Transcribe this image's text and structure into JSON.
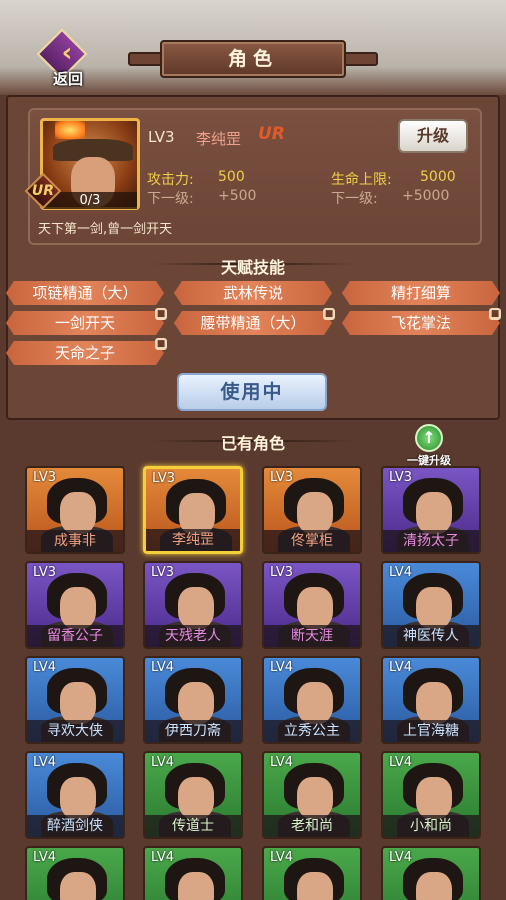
{
  "header": {
    "title": "角色",
    "back_label": "返回"
  },
  "hero": {
    "level": "LV3",
    "name": "李纯罡",
    "grade": "UR",
    "stars": "0/3",
    "upgrade_label": "升级",
    "attack_label": "攻击力:",
    "attack_value": "500",
    "next_label": "下一级:",
    "attack_next": "+500",
    "hp_label": "生命上限:",
    "hp_value": "5000",
    "hp_next": "+5000",
    "description": "天下第一剑,曾一剑开天"
  },
  "talents": {
    "title": "天赋技能",
    "skills": [
      {
        "label": "项链精通（大）",
        "locked": false
      },
      {
        "label": "武林传说",
        "locked": false
      },
      {
        "label": "精打细算",
        "locked": false
      },
      {
        "label": "一剑开天",
        "locked": true
      },
      {
        "label": "腰带精通（大）",
        "locked": true
      },
      {
        "label": "飞花掌法",
        "locked": true
      },
      {
        "label": "天命之子",
        "locked": true
      }
    ],
    "use_button": "使用中"
  },
  "roster": {
    "title": "已有角色",
    "one_click_upgrade": "一键升级",
    "characters": [
      {
        "lv": "LV3",
        "name": "成事非",
        "rarity": "orange"
      },
      {
        "lv": "LV3",
        "name": "李纯罡",
        "rarity": "orange",
        "selected": true
      },
      {
        "lv": "LV3",
        "name": "佟掌柜",
        "rarity": "orange"
      },
      {
        "lv": "LV3",
        "name": "清扬太子",
        "rarity": "purple"
      },
      {
        "lv": "LV3",
        "name": "留香公子",
        "rarity": "purple"
      },
      {
        "lv": "LV3",
        "name": "天残老人",
        "rarity": "purple"
      },
      {
        "lv": "LV3",
        "name": "断天涯",
        "rarity": "purple"
      },
      {
        "lv": "LV4",
        "name": "神医传人",
        "rarity": "blue"
      },
      {
        "lv": "LV4",
        "name": "寻欢大侠",
        "rarity": "blue"
      },
      {
        "lv": "LV4",
        "name": "伊西刀斋",
        "rarity": "blue"
      },
      {
        "lv": "LV4",
        "name": "立秀公主",
        "rarity": "blue"
      },
      {
        "lv": "LV4",
        "name": "上官海糖",
        "rarity": "blue"
      },
      {
        "lv": "LV4",
        "name": "醉酒剑侠",
        "rarity": "blue"
      },
      {
        "lv": "LV4",
        "name": "传道士",
        "rarity": "green"
      },
      {
        "lv": "LV4",
        "name": "老和尚",
        "rarity": "green"
      },
      {
        "lv": "LV4",
        "name": "小和尚",
        "rarity": "green"
      },
      {
        "lv": "LV4",
        "name": "",
        "rarity": "green"
      },
      {
        "lv": "LV4",
        "name": "",
        "rarity": "green"
      },
      {
        "lv": "LV4",
        "name": "",
        "rarity": "green"
      },
      {
        "lv": "LV4",
        "name": "",
        "rarity": "green"
      }
    ]
  }
}
